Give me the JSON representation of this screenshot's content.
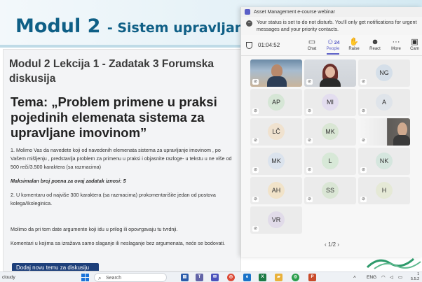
{
  "banner": {
    "title": "Modul 2",
    "subtitle": "- Sistem upravljanja infra"
  },
  "course": {
    "lesson_title": "Modul 2 Lekcija 1 - Zadatak 3 Forumska diskusija",
    "tema": "Tema: „Problem primene u praksi pojedinih elemenata sistema za upravljane imovinom”",
    "para1": "1. Molimo Vas da navedete koji od navedenih elemenata sistema za upravljanje imovinom , po Vašem mišljenju , predstavlja problem za primenu u praksi i objasnite razloge- u tekstu u ne više od 500 reči/3.500 karaktera (sa razmacima)",
    "max_points": "Maksimalan broj poena za ovaj zadatak iznosi: 5",
    "para2": "2. U komentaru od najviše 300 karaktera (sa razmacima) prokomentarišite jedan od postova kolega/Ikoleginica.",
    "para3": "Molimo da pri tom date argumente koji idu u prilog ili opovrgavaju tu tvrdnji.",
    "para4": "Komentari u kojima sa izražava samo slaganje ili neslaganje bez argumenata, neće se bodovati.",
    "add_button": "Dodaj novu temu za diskusiju"
  },
  "teams": {
    "window_title": "Asset Management e-course webinar",
    "notice": "Your status is set to do not disturb. You'll only get notifications for urgent messages and your priority contacts.",
    "timer": "01:04:52",
    "toolbar": [
      {
        "label": "Chat",
        "icon": "chat-icon"
      },
      {
        "label": "People",
        "icon": "people-icon",
        "count": "24"
      },
      {
        "label": "Raise",
        "icon": "raise-hand-icon"
      },
      {
        "label": "React",
        "icon": "react-icon"
      },
      {
        "label": "More",
        "icon": "more-icon"
      },
      {
        "label": "Cam",
        "icon": "camera-icon"
      }
    ],
    "participants": [
      {
        "initials": "",
        "video": "video-1"
      },
      {
        "initials": "",
        "video": "video-2"
      },
      {
        "initials": "NG",
        "color": "#d5dfe9"
      },
      {
        "initials": "AP",
        "color": "#d6e6d6"
      },
      {
        "initials": "MI",
        "color": "#e3ddef"
      },
      {
        "initials": "A",
        "color": "#dfe4ea"
      },
      {
        "initials": "LČ",
        "color": "#f0e2cf"
      },
      {
        "initials": "MK",
        "color": "#d9e6d4"
      },
      {
        "initials": "",
        "video": "video-3"
      },
      {
        "initials": "MK",
        "color": "#dbe3ed"
      },
      {
        "initials": "L",
        "color": "#d7e8d7"
      },
      {
        "initials": "NK",
        "color": "#d5e6de"
      },
      {
        "initials": "AH",
        "color": "#f1e3c9"
      },
      {
        "initials": "SS",
        "color": "#dae6d5"
      },
      {
        "initials": "H",
        "color": "#e5e9d6"
      },
      {
        "initials": "VR",
        "color": "#e1dbe9"
      }
    ],
    "pager": "1/2"
  },
  "taskbar": {
    "weather": "cloudy",
    "search_placeholder": "Search",
    "lang": "ENG",
    "clock_time": "1",
    "clock_date": "5.5.2"
  }
}
